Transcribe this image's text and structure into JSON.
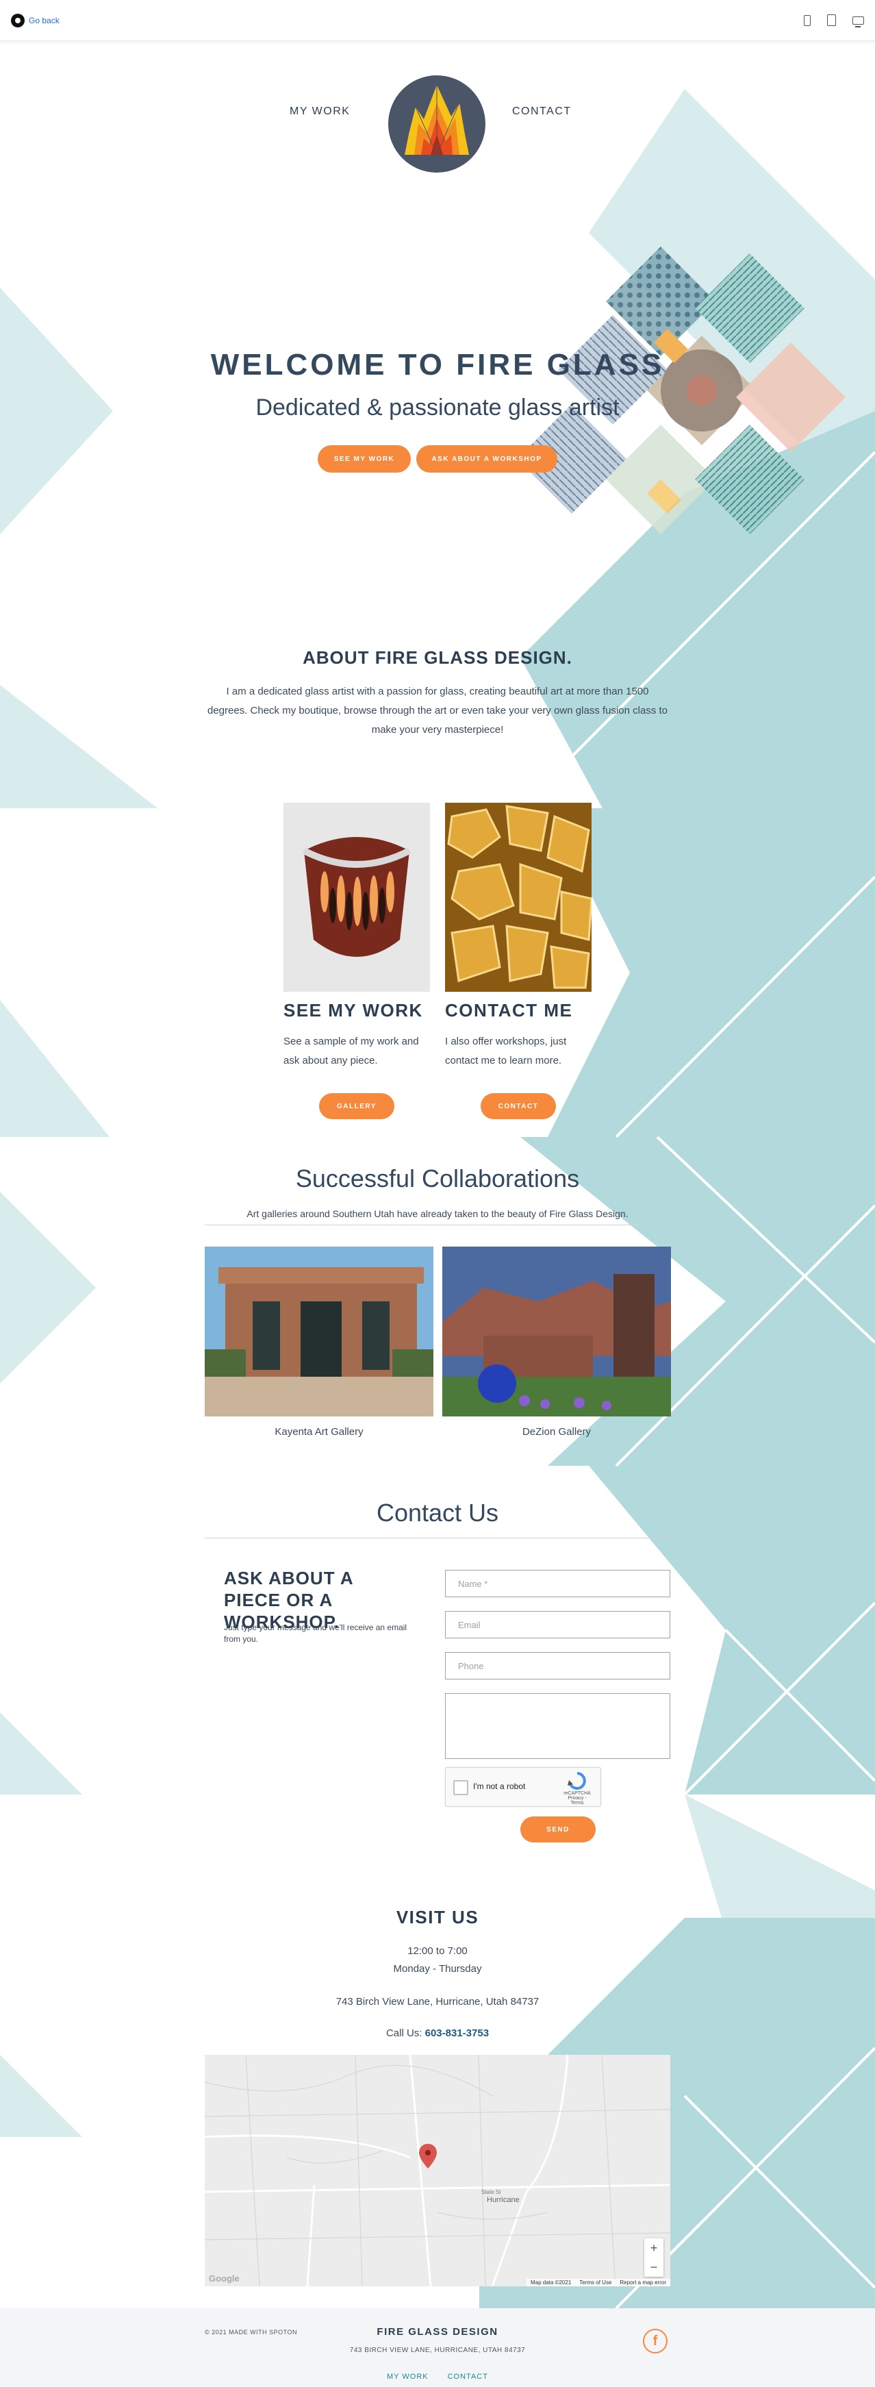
{
  "topbar": {
    "go_back": "Go back"
  },
  "nav": {
    "my_work": "MY WORK",
    "contact": "CONTACT"
  },
  "hero": {
    "title": "WELCOME TO FIRE GLASS",
    "subtitle": "Dedicated & passionate glass artist",
    "btn_work": "SEE MY WORK",
    "btn_workshop": "ASK ABOUT A WORKSHOP"
  },
  "about": {
    "title": "ABOUT FIRE GLASS DESIGN.",
    "text": "I am a dedicated glass artist with a passion for glass, creating beautiful art at more than 1500 degrees. Check my boutique, browse through the art or even take your very own glass fusion class to make your very masterpiece!"
  },
  "cards": [
    {
      "title": "SEE MY WORK",
      "text": "See a sample of my work and ask about any piece.",
      "button": "GALLERY"
    },
    {
      "title": "CONTACT ME",
      "text": "I also offer workshops, just contact me to learn more.",
      "button": "CONTACT"
    }
  ],
  "collab": {
    "title": "Successful Collaborations",
    "subtitle": "Art galleries around Southern Utah have already taken to the beauty of Fire Glass Design.",
    "galleries": [
      "Kayenta Art Gallery",
      "DeZion Gallery"
    ]
  },
  "contact": {
    "title": "Contact Us",
    "ask_title": "ASK ABOUT A PIECE OR A WORKSHOP.",
    "ask_text": "Just type your message and we'll receive an email from you.",
    "name_placeholder": "Name *",
    "email_placeholder": "Email",
    "phone_placeholder": "Phone",
    "captcha_label": "I'm not a robot",
    "captcha_brand": "reCAPTCHA",
    "captcha_terms": "Privacy - Terms",
    "send": "SEND"
  },
  "visit": {
    "title": "VISIT US",
    "hours": "12:00 to 7:00",
    "days": "Monday - Thursday",
    "address": "743 Birch View Lane, Hurricane, Utah 84737",
    "call_label": "Call Us:",
    "phone": "603-831-3753"
  },
  "map": {
    "town": "Hurricane",
    "road": "State St",
    "google": "Google",
    "map_data": "Map data ©2021",
    "terms": "Terms of Use",
    "report": "Report a map error"
  },
  "footer": {
    "made_with": "© 2021 MADE WITH SPOTON",
    "title": "FIRE GLASS DESIGN",
    "address": "743 BIRCH VIEW LANE, HURRICANE, UTAH 84737",
    "link_work": "MY WORK",
    "link_contact": "CONTACT",
    "fb": "f"
  },
  "colors": {
    "accent": "#f6893b",
    "teal": "#b2dadc",
    "teal_light": "#d8eced",
    "heading": "#2c3e50"
  },
  "icons": [
    "go-back-icon",
    "phone-icon",
    "tablet-icon",
    "desktop-icon",
    "facebook-icon",
    "map-pin-icon"
  ]
}
